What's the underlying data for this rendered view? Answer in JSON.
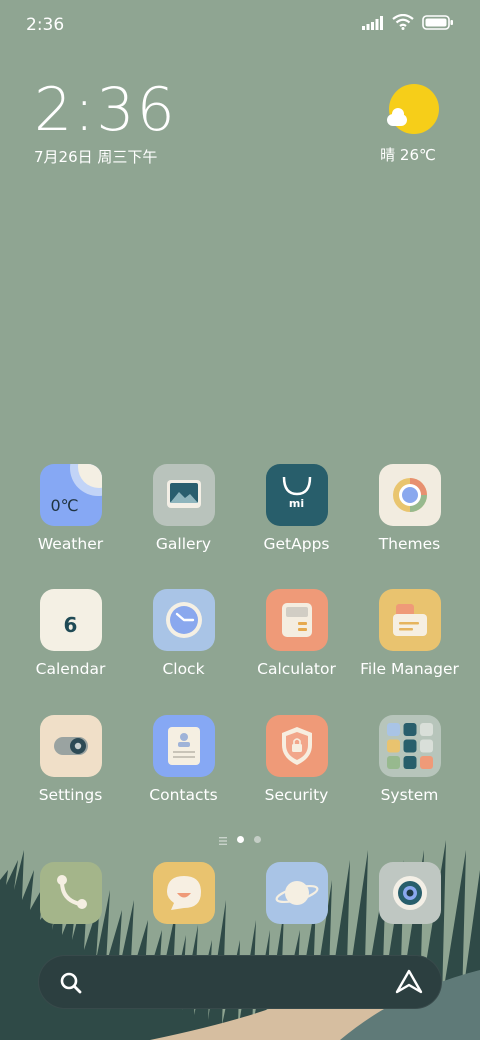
{
  "status_bar": {
    "time": "2:36"
  },
  "clock_widget": {
    "time": "2:36",
    "date": "7月26日 周三下午"
  },
  "weather_widget": {
    "summary": "晴 26℃"
  },
  "apps": [
    {
      "label": "Weather",
      "icon": "weather-icon",
      "sub": "0℃"
    },
    {
      "label": "Gallery",
      "icon": "gallery-icon"
    },
    {
      "label": "GetApps",
      "icon": "getapps-icon",
      "sub": "mi"
    },
    {
      "label": "Themes",
      "icon": "themes-icon"
    },
    {
      "label": "Calendar",
      "icon": "calendar-icon",
      "sub": "6"
    },
    {
      "label": "Clock",
      "icon": "clock-icon"
    },
    {
      "label": "Calculator",
      "icon": "calculator-icon"
    },
    {
      "label": "File Manager",
      "icon": "folder-icon"
    },
    {
      "label": "Settings",
      "icon": "settings-icon"
    },
    {
      "label": "Contacts",
      "icon": "contacts-icon"
    },
    {
      "label": "Security",
      "icon": "security-icon"
    },
    {
      "label": "System",
      "icon": "system-folder-icon"
    }
  ],
  "dock": [
    {
      "name": "phone",
      "icon": "phone-icon"
    },
    {
      "name": "messaging",
      "icon": "message-icon"
    },
    {
      "name": "browser",
      "icon": "planet-icon"
    },
    {
      "name": "camera",
      "icon": "camera-icon"
    }
  ],
  "pages": {
    "current": 1,
    "count": 2
  },
  "colors": {
    "background": "#8fa592",
    "trees": "#2f4a47",
    "path": "#d6bea0",
    "search_bar": "#2c3f40"
  }
}
